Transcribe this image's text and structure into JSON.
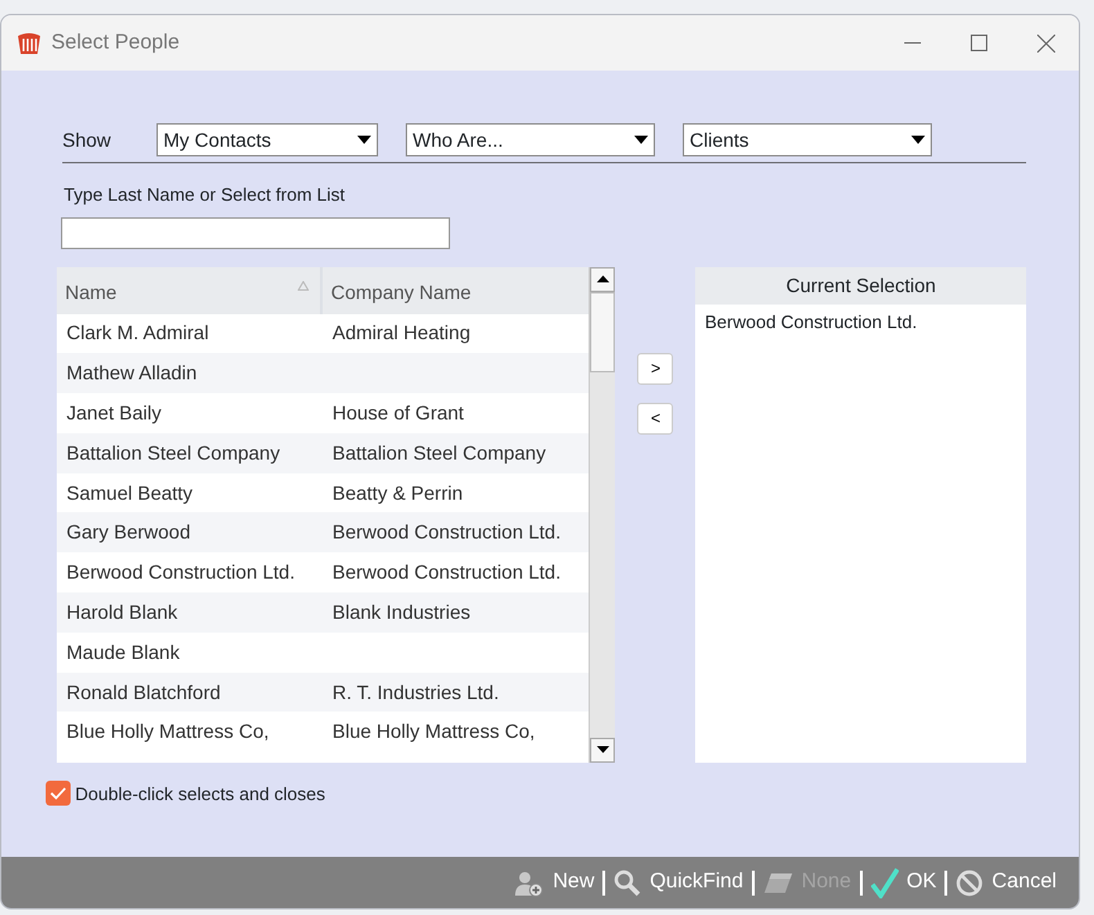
{
  "window": {
    "title": "Select People"
  },
  "filters": {
    "label": "Show",
    "dropdowns": [
      {
        "value": "My Contacts"
      },
      {
        "value": "Who Are..."
      },
      {
        "value": "Clients"
      }
    ]
  },
  "search": {
    "label": "Type Last Name or Select from List"
  },
  "table": {
    "columns": [
      {
        "label": "Name",
        "sorted": true
      },
      {
        "label": "Company Name",
        "sorted": false
      }
    ],
    "rows": [
      {
        "name": "Clark M. Admiral",
        "company": "Admiral Heating"
      },
      {
        "name": "Mathew Alladin"
      },
      {
        "name": "Janet Baily",
        "company": "House of Grant"
      },
      {
        "name": "Battalion Steel Company",
        "company": "Battalion Steel Company"
      },
      {
        "name": "Samuel Beatty",
        "company": "Beatty & Perrin"
      },
      {
        "name": "Gary Berwood",
        "company": "Berwood Construction Ltd."
      },
      {
        "name": "Berwood Construction Ltd.",
        "company": "Berwood Construction Ltd."
      },
      {
        "name": "Harold Blank",
        "company": "Blank Industries"
      },
      {
        "name": "Maude Blank"
      },
      {
        "name": "Ronald Blatchford",
        "company": "R. T. Industries Ltd."
      },
      {
        "name": "Blue Holly Mattress Co,",
        "company": "Blue Holly Mattress Co,"
      }
    ]
  },
  "transfer_buttons": [
    ">",
    "<"
  ],
  "selection": {
    "title": "Current Selection",
    "items": [
      "Berwood Construction Ltd."
    ]
  },
  "options": [
    {
      "label": "Double-click selects and closes",
      "checked": true
    }
  ],
  "toolbar": [
    {
      "kind": "new",
      "label": "New",
      "disabled": false
    },
    {
      "kind": "quickfind",
      "label": "QuickFind",
      "disabled": false
    },
    {
      "kind": "none",
      "label": "None",
      "disabled": true
    },
    {
      "kind": "ok",
      "label": "OK",
      "disabled": false
    },
    {
      "kind": "cancel",
      "label": "Cancel",
      "disabled": false
    }
  ]
}
